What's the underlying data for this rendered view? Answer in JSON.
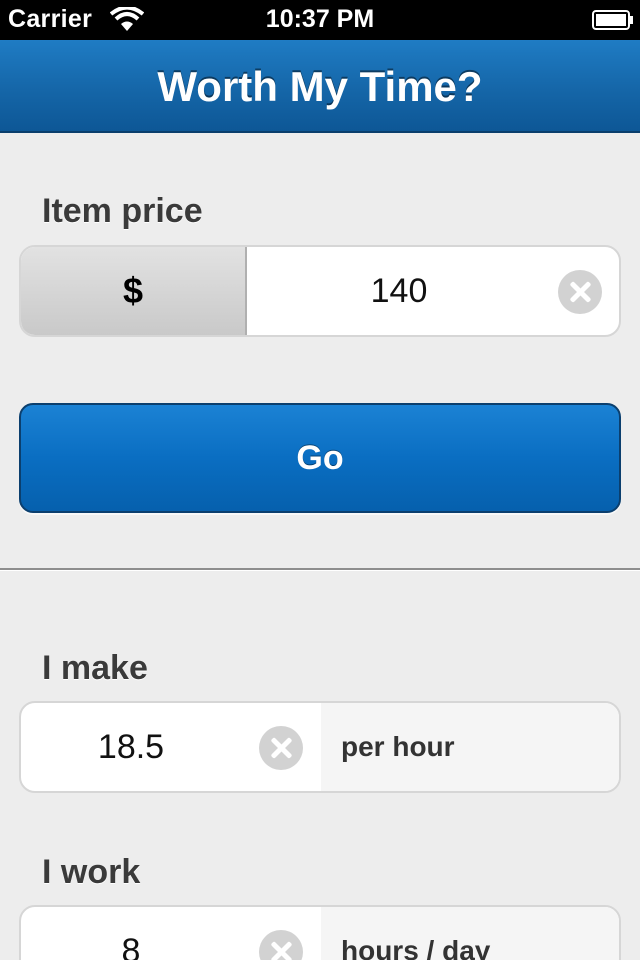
{
  "status_bar": {
    "carrier": "Carrier",
    "time": "10:37 PM",
    "icons": [
      "wifi-icon",
      "battery-icon"
    ]
  },
  "nav": {
    "title": "Worth My Time?"
  },
  "price_section": {
    "label": "Item price",
    "currency": "$",
    "value": "140"
  },
  "go_button": {
    "label": "Go"
  },
  "income_section": {
    "label": "I make",
    "value": "18.5",
    "unit": "per hour"
  },
  "work_section": {
    "label": "I work",
    "value": "8",
    "unit": "hours / day"
  },
  "colors": {
    "accent_blue": "#0a6ec2",
    "nav_blue": "#1566a8",
    "background": "#ededed"
  }
}
